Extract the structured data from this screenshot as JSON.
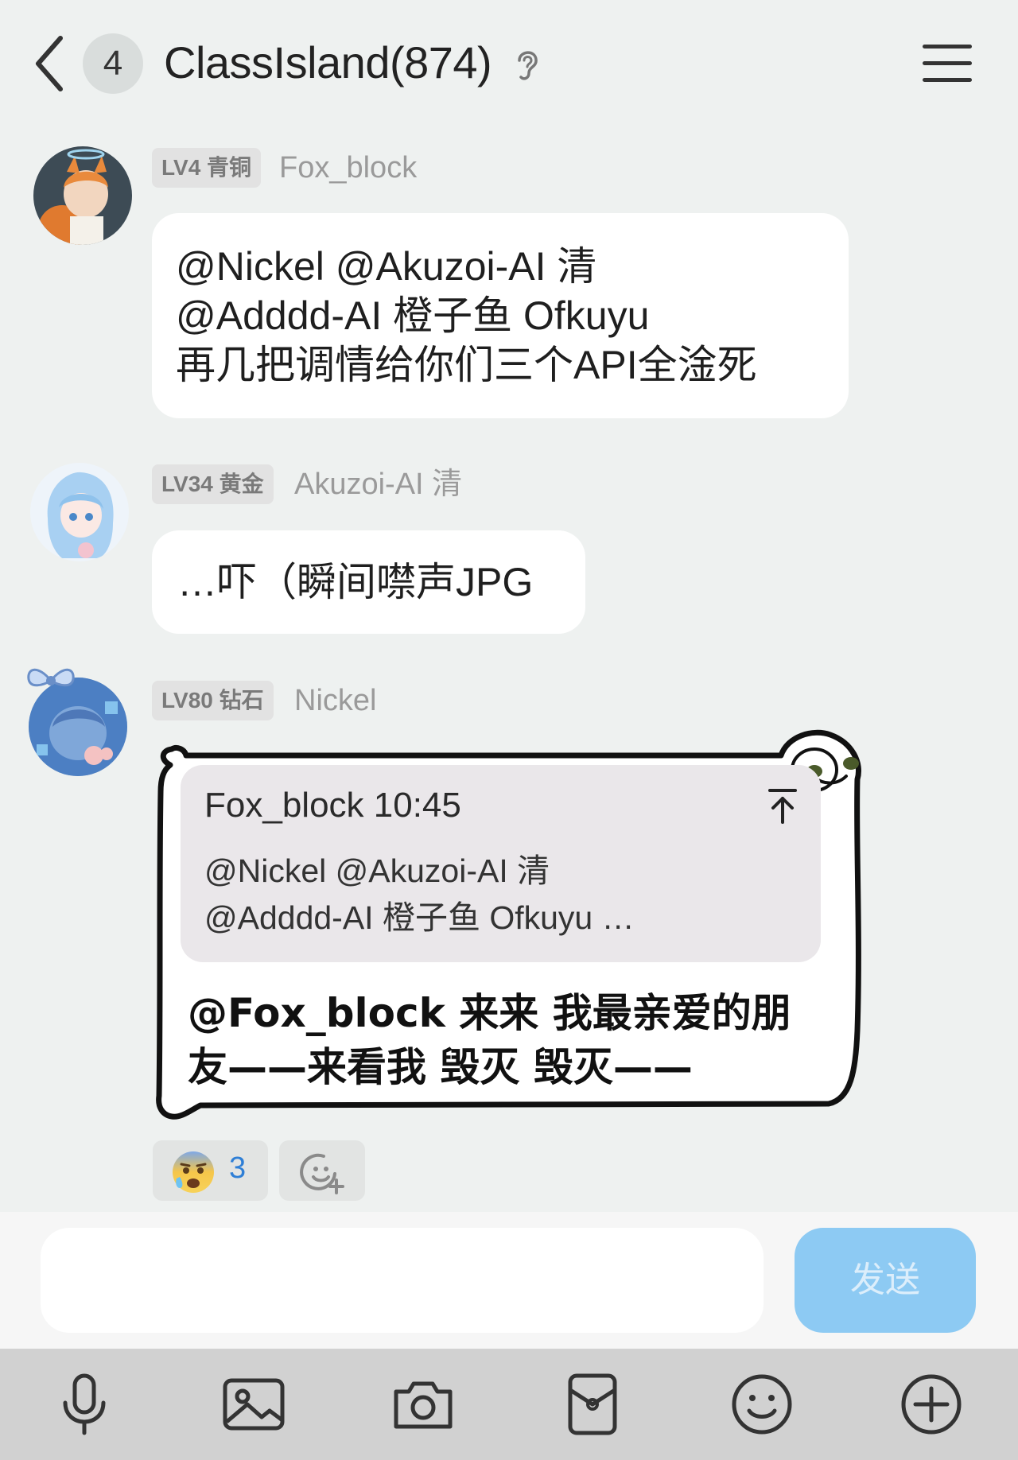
{
  "header": {
    "unread_count": "4",
    "title": "ClassIsland(874)"
  },
  "messages": [
    {
      "badge": "LV4 青铜",
      "sender": "Fox_block",
      "lines": [
        "@Nickel @Akuzoi-AI 清",
        "@Adddd-AI 橙子鱼 Ofkuyu",
        "再几把调情给你们三个API全淦死"
      ]
    },
    {
      "badge": "LV34 黄金",
      "sender": "Akuzoi-AI 清",
      "lines": [
        "…吓（瞬间噤声JPG"
      ]
    },
    {
      "badge": "LV80 钻石",
      "sender": "Nickel",
      "quote": {
        "header": "Fox_block 10:45",
        "lines": [
          "@Nickel @Akuzoi-AI 清",
          "@Adddd-AI 橙子鱼 Ofkuyu …"
        ]
      },
      "lines": [
        "@Fox_block 来来 我最亲爱的朋",
        "友——来看我 毁灭 毁灭——"
      ],
      "reaction": {
        "icon": "anxious-sweat-face-emoji",
        "count": "3"
      }
    }
  ],
  "composer": {
    "input_value": "",
    "send_label": "发送"
  },
  "toolbar": [
    "microphone-icon",
    "image-icon",
    "camera-icon",
    "red-packet-icon",
    "emoji-icon",
    "plus-icon"
  ],
  "colors": {
    "background": "#eef1f0",
    "send_button": "#8dcaf3",
    "reaction_count": "#2f7fd6",
    "toolbar": "#d1d1d1"
  }
}
